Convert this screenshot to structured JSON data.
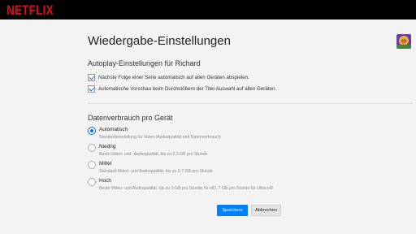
{
  "header": {
    "logo_text": "NETFLIX",
    "brand_color": "#e50914"
  },
  "page": {
    "title": "Wiedergabe-Einstellungen",
    "profile_avatar": "profile-avatar-icon"
  },
  "autoplay": {
    "heading": "Autoplay-Einstellungen für Richard",
    "options": [
      {
        "label": "Nächste Folge einer Serie automatisch auf allen Geräten abspielen.",
        "checked": true
      },
      {
        "label": "Automatische Vorschau beim Durchstöbern der Titel-Auswahl auf allen Geräten.",
        "checked": true
      }
    ]
  },
  "data_usage": {
    "heading": "Datenverbrauch pro Gerät",
    "options": [
      {
        "label": "Automatisch",
        "description": "Standardeinstellung für Video-/Audioqualität und Datenverbrauch",
        "selected": true
      },
      {
        "label": "Niedrig",
        "description": "Basis-Video- und -Audioqualität, bis zu 0,3 GB pro Stunde",
        "selected": false
      },
      {
        "label": "Mittel",
        "description": "Standard-Video- und Audioqualität, bis zu 0,7 GB pro Stunde",
        "selected": false
      },
      {
        "label": "Hoch",
        "description": "Beste Video- und Audioqualität, bis zu 3 GB pro Stunde für HD, 7 GB pro Stunde für Ultra-HD",
        "selected": false
      }
    ]
  },
  "actions": {
    "save_label": "Speichern",
    "cancel_label": "Abbrechen",
    "accent_color": "#0080ff"
  }
}
